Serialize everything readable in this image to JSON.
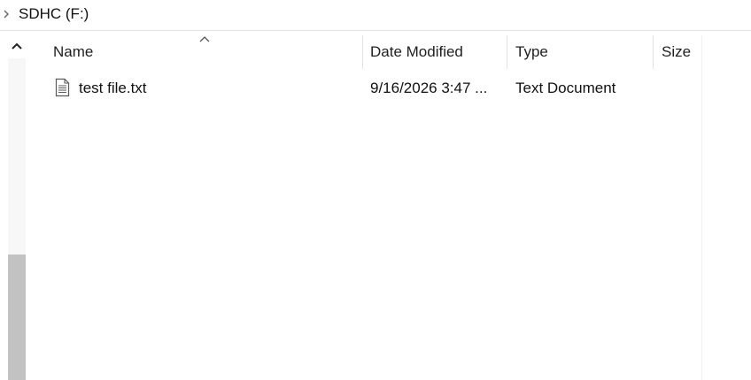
{
  "breadcrumb": {
    "location": "SDHC (F:)",
    "chevron_icon": "chevron-right-icon"
  },
  "scrollbar": {
    "up_icon": "chevron-up-icon"
  },
  "columns": {
    "name": "Name",
    "date_modified": "Date Modified",
    "type": "Type",
    "size": "Size",
    "sort_icon": "sort-ascending-icon"
  },
  "files": [
    {
      "icon": "text-document-icon",
      "name": "test file.txt",
      "date_modified": "9/16/2026 3:47 ...",
      "type": "Text Document",
      "size": ""
    }
  ],
  "colors": {
    "scroll_thumb": "#c2c2c2",
    "separator": "#e2e2e2"
  }
}
